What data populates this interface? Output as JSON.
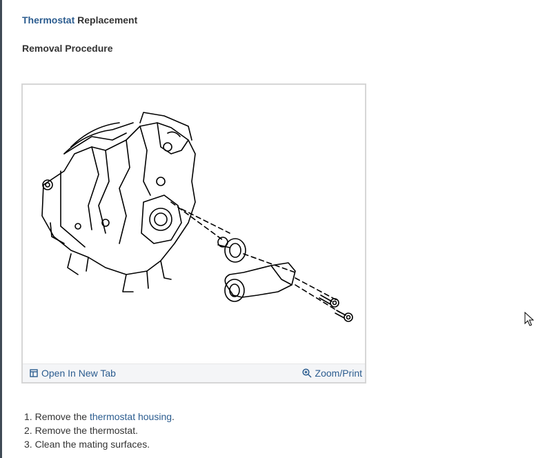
{
  "title": {
    "link_text": "Thermostat",
    "rest_text": " Replacement"
  },
  "subtitle": "Removal Procedure",
  "figure": {
    "open_new_tab_label": "Open In New Tab",
    "zoom_print_label": "Zoom/Print",
    "open_icon": "open-in-new-tab-icon",
    "zoom_icon": "magnifier-plus-icon"
  },
  "steps": [
    {
      "number": "1.",
      "pre": " Remove the ",
      "link": "thermostat housing",
      "post": "."
    },
    {
      "number": "2.",
      "text": " Remove the thermostat."
    },
    {
      "number": "3.",
      "text": " Clean the mating surfaces."
    }
  ],
  "colors": {
    "link": "#2b5c8f",
    "text": "#333333",
    "frame_border": "#d6d6d6",
    "bar_bg": "#f4f5f7"
  }
}
